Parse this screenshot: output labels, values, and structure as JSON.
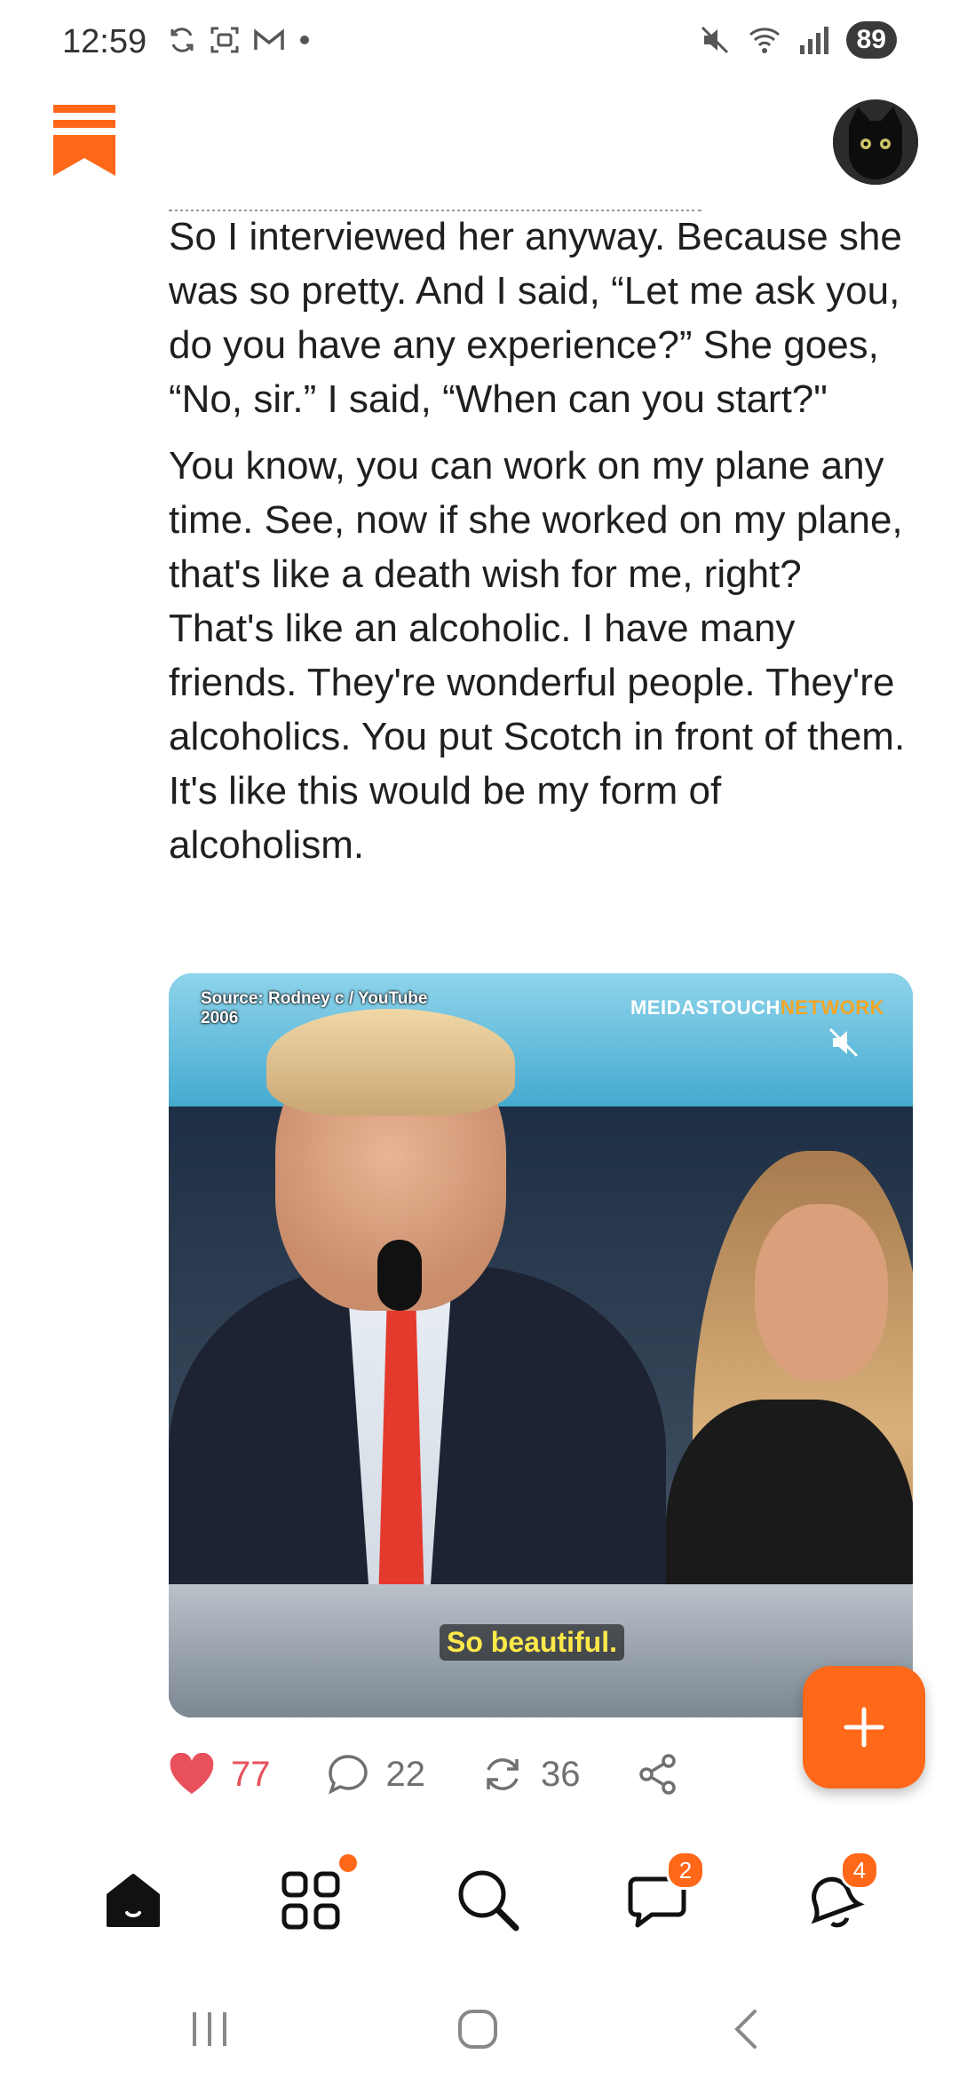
{
  "status_bar": {
    "time": "12:59",
    "battery": "89",
    "left_icons": [
      "sync-icon",
      "screenshot-icon",
      "gmail-icon",
      "dot-icon"
    ],
    "right_icons": [
      "mute-icon",
      "wifi-icon",
      "signal-icon"
    ]
  },
  "header": {
    "logo_icon": "substack-logo-icon",
    "avatar_icon": "black-cat-avatar"
  },
  "article": {
    "paragraphs": [
      "So I interviewed her anyway. Because she was so pretty. And I said, “Let me ask you, do you have any experience?” She goes, “No, sir.” I said, “When can you start?\"",
      "You know, you can work on my plane any time. See, now if she worked on my plane, that's like a death wish for me, right? That's like an alcoholic. I have many friends. They're wonderful people. They're alcoholics. You put Scotch in front of them. It's like this would be my form of alcoholism."
    ]
  },
  "video": {
    "source_line1": "Source: Rodney c / YouTube",
    "source_line2": "2006",
    "brand_main": "MEIDASTOUCH",
    "brand_suffix": "NETWORK",
    "caption": "So beautiful.",
    "muted": true
  },
  "actions": {
    "likes": "77",
    "comments": "22",
    "restacks": "36",
    "like_icon": "heart-icon",
    "comment_icon": "comment-icon",
    "restack_icon": "restack-icon",
    "share_icon": "share-icon"
  },
  "fab": {
    "icon": "plus-icon"
  },
  "bottom_nav": {
    "items": [
      {
        "name": "home",
        "icon": "home-icon"
      },
      {
        "name": "explore",
        "icon": "grid-icon",
        "dot": true
      },
      {
        "name": "search",
        "icon": "search-icon"
      },
      {
        "name": "chat",
        "icon": "chat-icon",
        "badge": "2"
      },
      {
        "name": "activity",
        "icon": "bell-icon",
        "badge": "4"
      }
    ]
  },
  "colors": {
    "accent": "#ff6719",
    "like": "#e8515b",
    "text": "#1f1f1f",
    "muted": "#707070"
  }
}
